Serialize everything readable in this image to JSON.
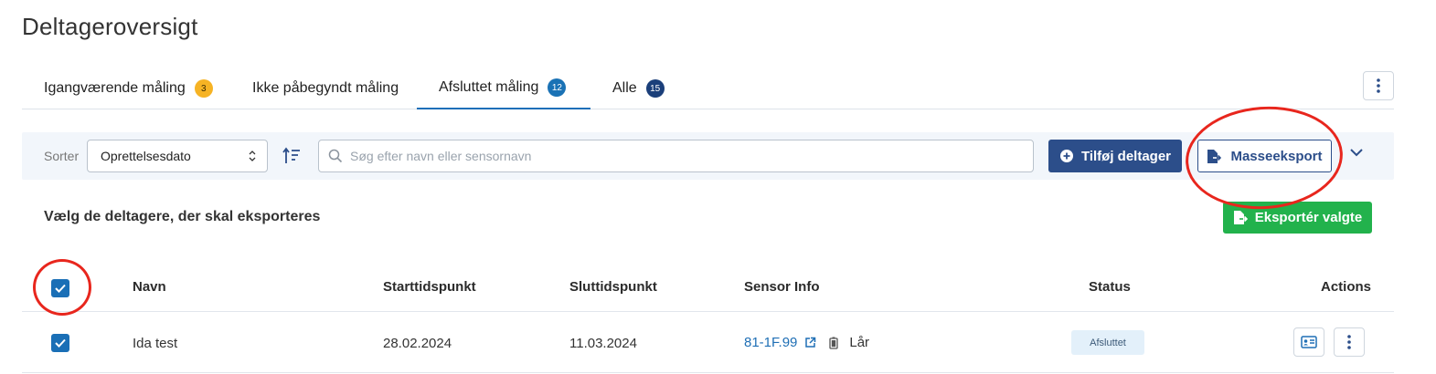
{
  "page": {
    "title": "Deltageroversigt"
  },
  "tabs": [
    {
      "label": "Igangværende måling",
      "count": "3",
      "badge_color": "#f6b324"
    },
    {
      "label": "Ikke påbegyndt måling",
      "count": ""
    },
    {
      "label": "Afsluttet måling",
      "count": "12",
      "badge_color": "#1a72b5",
      "active": true
    },
    {
      "label": "Alle",
      "count": "15",
      "badge_color": "#1b3f7a"
    }
  ],
  "toolbar": {
    "sort_label": "Sorter",
    "sort_value": "Oprettelsesdato",
    "search_placeholder": "Søg efter navn eller sensornavn",
    "add_label": "Tilføj deltager",
    "export_label": "Masseeksport"
  },
  "selection": {
    "title": "Vælg de deltagere, der skal eksporteres",
    "export_selected_label": "Eksportér valgte"
  },
  "table": {
    "headers": {
      "name": "Navn",
      "start": "Starttidspunkt",
      "end": "Sluttidspunkt",
      "sensor": "Sensor Info",
      "status": "Status",
      "actions": "Actions"
    },
    "rows": [
      {
        "name": "Ida test",
        "start": "28.02.2024",
        "end": "11.03.2024",
        "sensor_id": "81-1F.99",
        "sensor_location": "Lår",
        "status": "Afsluttet",
        "checked": true
      }
    ]
  },
  "colors": {
    "primary": "#2c4e8a",
    "link": "#1f6fb5",
    "success": "#22b24c",
    "annotation": "#e8261d"
  }
}
